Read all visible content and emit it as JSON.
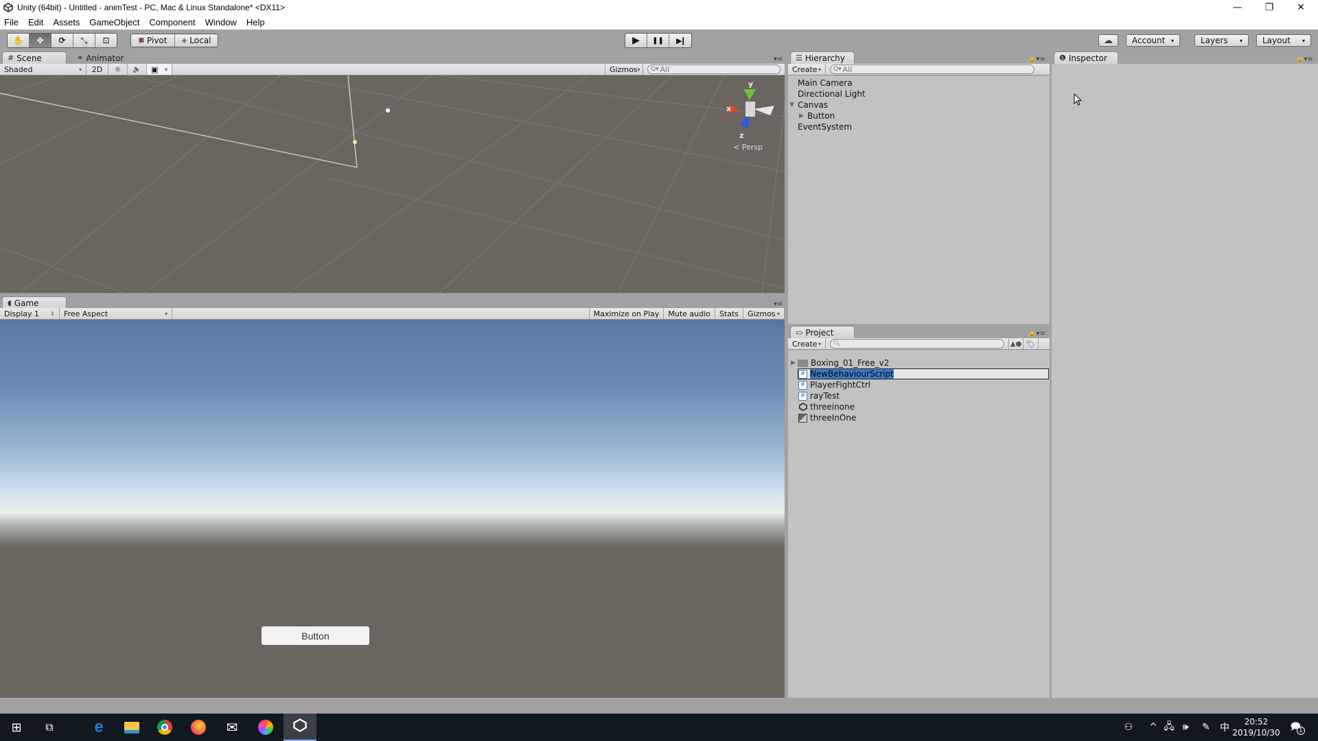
{
  "window": {
    "title": "Unity (64bit) - Untitled - animTest - PC, Mac & Linux Standalone* <DX11>",
    "controls": {
      "minimize": "—",
      "restore": "❐",
      "close": "✕"
    }
  },
  "menu": [
    "File",
    "Edit",
    "Assets",
    "GameObject",
    "Component",
    "Window",
    "Help"
  ],
  "toolbar": {
    "transform_tools": [
      {
        "name": "hand-tool",
        "glyph": "✋",
        "active": false
      },
      {
        "name": "move-tool",
        "glyph": "✥",
        "active": true
      },
      {
        "name": "rotate-tool",
        "glyph": "⟳",
        "active": false
      },
      {
        "name": "scale-tool",
        "glyph": "⤡",
        "active": false
      },
      {
        "name": "rect-tool",
        "glyph": "⊡",
        "active": false
      }
    ],
    "pivot_label": "Pivot",
    "local_label": "Local",
    "play_glyph": "▶",
    "pause_glyph": "❚❚",
    "step_glyph": "▶❙",
    "cloud_glyph": "☁",
    "account_label": "Account",
    "layers_label": "Layers",
    "layout_label": "Layout",
    "caret": "▾"
  },
  "scene": {
    "tabs": [
      {
        "label": "Scene",
        "icon": "#"
      },
      {
        "label": "Animator",
        "icon": "⚭"
      }
    ],
    "shading": "Shaded",
    "mode_2d": "2D",
    "light_glyph": "☼",
    "audio_glyph": "🔈",
    "fx_glyph": "▣",
    "gizmos_label": "Gizmos",
    "search_placeholder": "All",
    "axis_labels": {
      "x": "x",
      "y": "y",
      "z": "z"
    },
    "projection_label": "Persp"
  },
  "game": {
    "tab_label": "Game",
    "tab_icon": "◖",
    "display": "Display 1",
    "aspect": "Free Aspect",
    "toggles": [
      "Maximize on Play",
      "Mute audio",
      "Stats",
      "Gizmos"
    ],
    "ui_button_label": "Button"
  },
  "hierarchy": {
    "tab_label": "Hierarchy",
    "tab_icon": "☰",
    "create_label": "Create",
    "search_placeholder": "All",
    "items": [
      {
        "label": "Main Camera",
        "depth": 0,
        "expander": ""
      },
      {
        "label": "Directional Light",
        "depth": 0,
        "expander": ""
      },
      {
        "label": "Canvas",
        "depth": 0,
        "expander": "▼"
      },
      {
        "label": "Button",
        "depth": 1,
        "expander": "▶"
      },
      {
        "label": "EventSystem",
        "depth": 0,
        "expander": ""
      }
    ]
  },
  "project": {
    "tab_label": "Project",
    "tab_icon": "▭",
    "create_label": "Create",
    "search_placeholder": "",
    "items": [
      {
        "label": "Boxing_01_Free_v2",
        "type": "folder",
        "expander": "▶",
        "selected": false
      },
      {
        "label": "NewBehaviourScript",
        "type": "csharp-script",
        "expander": "",
        "selected": true
      },
      {
        "label": "PlayerFightCtrl",
        "type": "csharp-script",
        "expander": "",
        "selected": false
      },
      {
        "label": "rayTest",
        "type": "csharp-script",
        "expander": "",
        "selected": false
      },
      {
        "label": "threeinone",
        "type": "unity-scene",
        "expander": "",
        "selected": false
      },
      {
        "label": "threeInOne",
        "type": "sprite",
        "expander": "",
        "selected": false
      }
    ]
  },
  "inspector": {
    "tab_label": "Inspector",
    "tab_icon": "❶"
  },
  "taskbar": {
    "time": "20:52",
    "date": "2019/10/30",
    "ime": "中",
    "notification_count": "1",
    "apps": [
      "start",
      "task-view",
      "edge",
      "file-explorer",
      "chrome",
      "firefox",
      "mail",
      "color-app",
      "unity"
    ]
  }
}
